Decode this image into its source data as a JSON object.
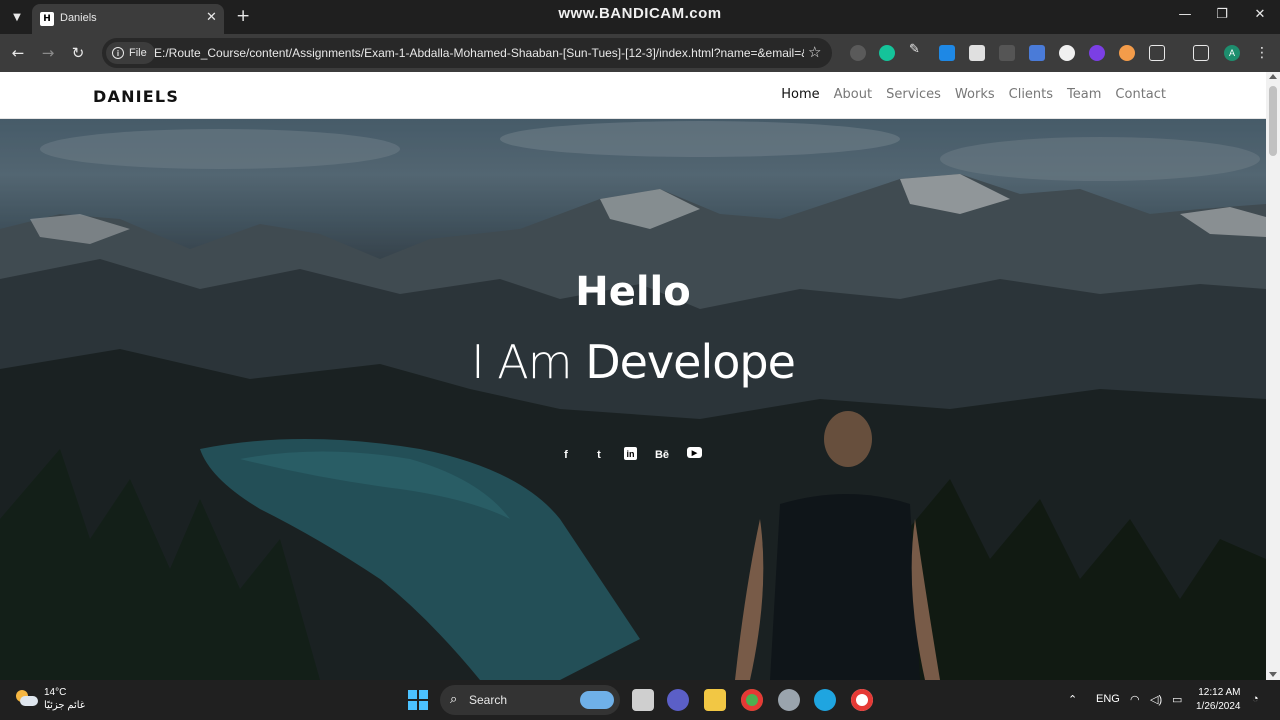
{
  "browser": {
    "tab_title": "Daniels",
    "tab_favicon": "H",
    "watermark": "www.BANDICAM.com",
    "site_info_label": "File",
    "url": "E:/Route_Course/content/Assignments/Exam-1-Abdalla-Mohamed-Shaaban-[Sun-Tues]-[12-3]/index.html?name=&email=&...",
    "profile_initial": "A"
  },
  "site": {
    "brand": "DANIELS",
    "nav": [
      "Home",
      "About",
      "Services",
      "Works",
      "Clients",
      "Team",
      "Contact"
    ],
    "hero_title": "Hello",
    "hero_prefix": "I Am",
    "hero_typed": "Develope",
    "socials": [
      "f",
      "t",
      "in",
      "Bē",
      "yt"
    ]
  },
  "taskbar": {
    "temperature": "14°C",
    "weather_desc": "غائم جزئيًا",
    "search_label": "Search",
    "language": "ENG",
    "time": "12:12 AM",
    "date": "1/26/2024"
  },
  "colors": {
    "chrome_dark": "#1f1f1f",
    "chrome_toolbar": "#3c3c3c",
    "nav_active": "#111111",
    "nav_inactive": "#777777",
    "start_blue": "#4cc2ff"
  }
}
